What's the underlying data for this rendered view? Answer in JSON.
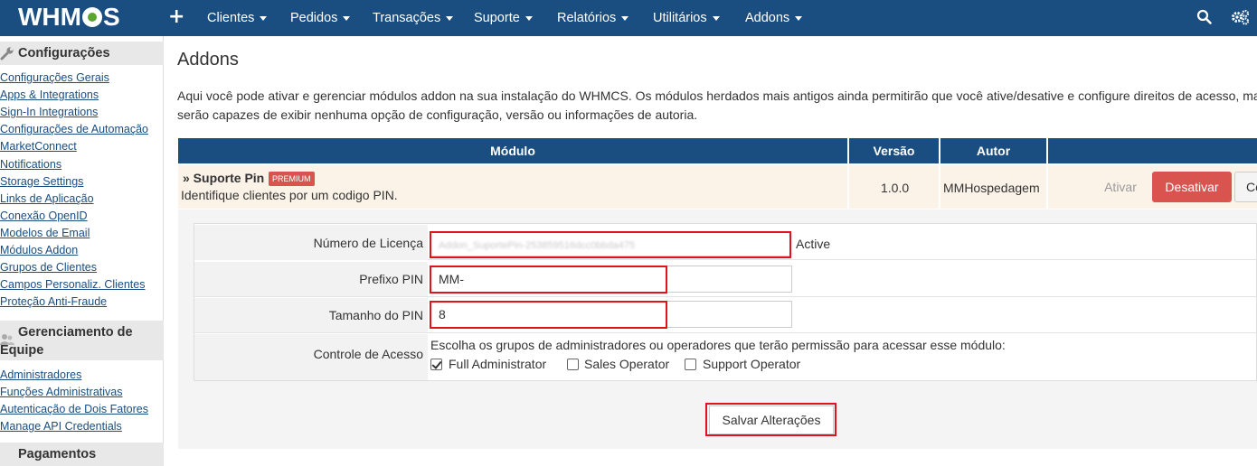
{
  "topbar": {
    "logo": "WHMCS",
    "logo_left": "WHM",
    "logo_right": "S",
    "add_icon": "plus-icon",
    "menu": [
      {
        "label": "Clientes"
      },
      {
        "label": "Pedidos"
      },
      {
        "label": "Transações"
      },
      {
        "label": "Suporte"
      },
      {
        "label": "Relatórios"
      },
      {
        "label": "Utilitários"
      },
      {
        "label": "Addons"
      }
    ],
    "right_icons": [
      "search-icon",
      "gears-icon"
    ]
  },
  "sidebar": {
    "sections": [
      {
        "title": "Configurações",
        "icon": "wrench-icon",
        "links": [
          "Configurações Gerais",
          "Apps & Integrations",
          "Sign-In Integrations",
          "Configurações de Automação",
          "MarketConnect",
          "Notifications",
          "Storage Settings",
          "Links de Aplicação",
          "Conexão OpenID",
          "Modelos de Email",
          "Módulos Addon",
          "Grupos de Clientes",
          "Campos Personaliz. Clientes",
          "Proteção Anti-Fraude"
        ]
      },
      {
        "title_line1": "Gerenciamento de",
        "title_line2": "Equipe",
        "icon": "users-icon",
        "links": [
          "Administradores",
          "Funções Administrativas",
          "Autenticação de Dois Fatores",
          "Manage API Credentials"
        ]
      },
      {
        "title": "Pagamentos"
      }
    ]
  },
  "main": {
    "title": "Addons",
    "description_line1": "Aqui você pode ativar e gerenciar módulos addon na sua instalação do WHMCS. Os módulos herdados mais antigos ainda permitirão que você ative/desative e configure direitos de acesso, mas não",
    "description_line2": "serão capazes de exibir nenhuma opção de configuração, versão ou informações de autoria.",
    "table": {
      "headers": [
        "Módulo",
        "Versão",
        "Autor",
        ""
      ],
      "row": {
        "name": "» Suporte Pin",
        "badge": "PREMIUM",
        "description": "Identifique clientes por um codigo PIN.",
        "version": "1.0.0",
        "author": "MMHospedagem",
        "activate_label": "Ativar",
        "deactivate_label": "Desativar",
        "configure_label": "Configurar"
      }
    },
    "config": {
      "license_label": "Número de Licença",
      "license_value": "Addon_SuportePin-253859516dcc0bbda475",
      "license_status": "Active",
      "prefix_label": "Prefixo PIN",
      "prefix_value": "MM-",
      "size_label": "Tamanho do PIN",
      "size_value": "8",
      "access_label": "Controle de Acesso",
      "access_text": "Escolha os grupos de administradores ou operadores que terão permissão para acessar esse módulo:",
      "groups": [
        {
          "label": "Full Administrator",
          "checked": true
        },
        {
          "label": "Sales Operator",
          "checked": false
        },
        {
          "label": "Support Operator",
          "checked": false
        }
      ],
      "save_label": "Salvar Alterações"
    },
    "highlight_color": "#e0121a",
    "accent_color": "#1a4d80"
  }
}
